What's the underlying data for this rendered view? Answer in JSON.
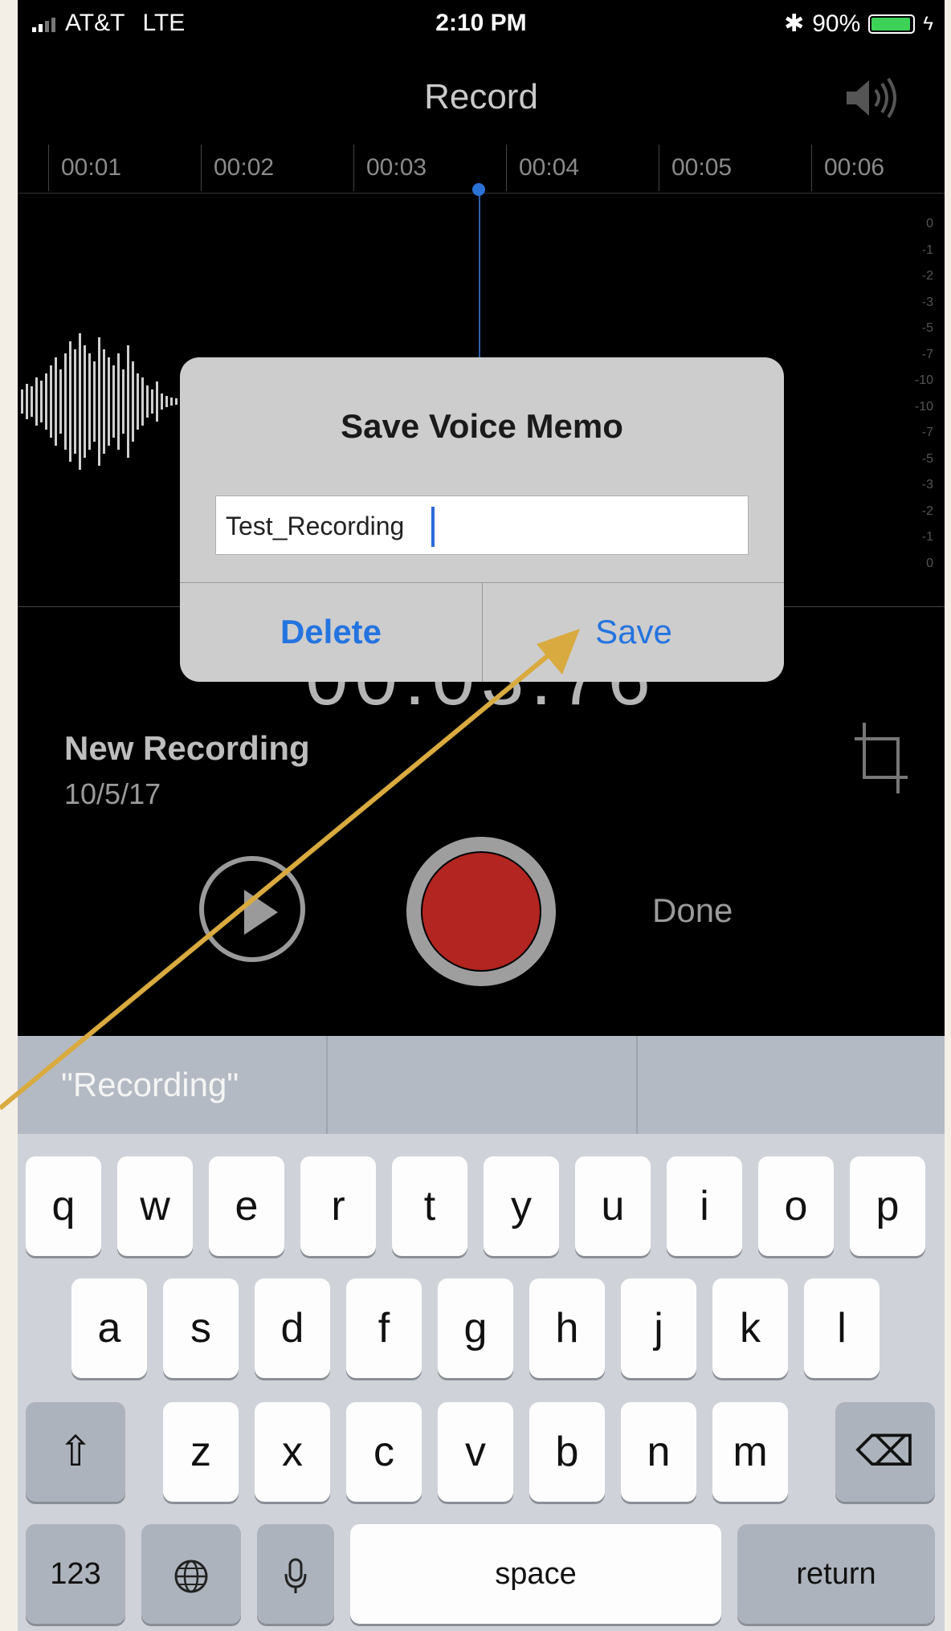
{
  "status_bar": {
    "carrier": "AT&T",
    "network": "LTE",
    "time": "2:10 PM",
    "bluetooth": "✱",
    "battery": "90%",
    "battery_color": "#3ed158"
  },
  "nav": {
    "title": "Record",
    "speaker_icon": "speaker-icon"
  },
  "timeline": {
    "labels": [
      "00:01",
      "00:02",
      "00:03",
      "00:04",
      "00:05",
      "00:06"
    ],
    "db_scale": [
      "0",
      "-1",
      "-2",
      "-3",
      "-5",
      "-7",
      "-10",
      "-10",
      "-7",
      "-5",
      "-3",
      "-2",
      "-1",
      "0"
    ]
  },
  "timer": "00:03.76",
  "recording": {
    "name": "New Recording",
    "date": "10/5/17"
  },
  "controls": {
    "done_label": "Done"
  },
  "dialog": {
    "title": "Save Voice Memo",
    "input_value": "Test_Recording",
    "delete_label": "Delete",
    "save_label": "Save",
    "accent_color": "#2474e0"
  },
  "keyboard": {
    "suggestions": [
      "\"Recording\"",
      "",
      ""
    ],
    "row1": [
      "q",
      "w",
      "e",
      "r",
      "t",
      "y",
      "u",
      "i",
      "o",
      "p"
    ],
    "row2": [
      "a",
      "s",
      "d",
      "f",
      "g",
      "h",
      "j",
      "k",
      "l"
    ],
    "row3": [
      "z",
      "x",
      "c",
      "v",
      "b",
      "n",
      "m"
    ],
    "shift_icon": "⇧",
    "delete_icon": "⌫",
    "numbers_label": "123",
    "globe_icon": "globe-icon",
    "mic_icon": "microphone-icon",
    "space_label": "space",
    "return_label": "return"
  },
  "annotation": {
    "arrow_color": "#d9aa3f"
  }
}
